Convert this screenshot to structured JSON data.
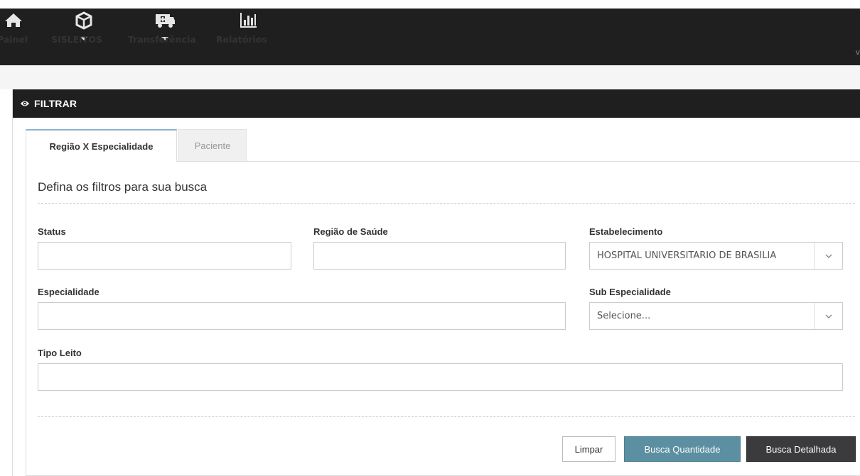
{
  "nav": {
    "items": [
      {
        "label": "Painel",
        "icon": "home-icon"
      },
      {
        "label": "SISLEITOS",
        "icon": "cube-icon"
      },
      {
        "label": "Transferência",
        "icon": "ambulance-icon"
      },
      {
        "label": "Relatórios",
        "icon": "bar-chart-icon"
      }
    ],
    "version": "v"
  },
  "panel": {
    "title": "FILTRAR",
    "tabs": [
      {
        "label": "Região X Especialidade",
        "active": true
      },
      {
        "label": "Paciente",
        "active": false
      }
    ],
    "section_title": "Defina os filtros para sua busca",
    "fields": {
      "status": {
        "label": "Status",
        "value": ""
      },
      "regiao": {
        "label": "Região de Saúde",
        "value": ""
      },
      "estabelecimento": {
        "label": "Estabelecimento",
        "value": "HOSPITAL UNIVERSITÁRIO DE BRASÍLIA"
      },
      "especialidade": {
        "label": "Especialidade",
        "value": ""
      },
      "sub_especialidade": {
        "label": "Sub Especialidade",
        "value": "Selecione..."
      },
      "tipo_leito": {
        "label": "Tipo Leito",
        "value": ""
      }
    },
    "buttons": {
      "clear": "Limpar",
      "quantity": "Busca Quantidade",
      "detailed": "Busca Detalhada"
    }
  },
  "colors": {
    "nav_bg": "#1f1f20",
    "btn_quantity": "#5b8fa1",
    "btn_detailed": "#3b3b3d",
    "tab_accent": "#8fb2cc"
  }
}
